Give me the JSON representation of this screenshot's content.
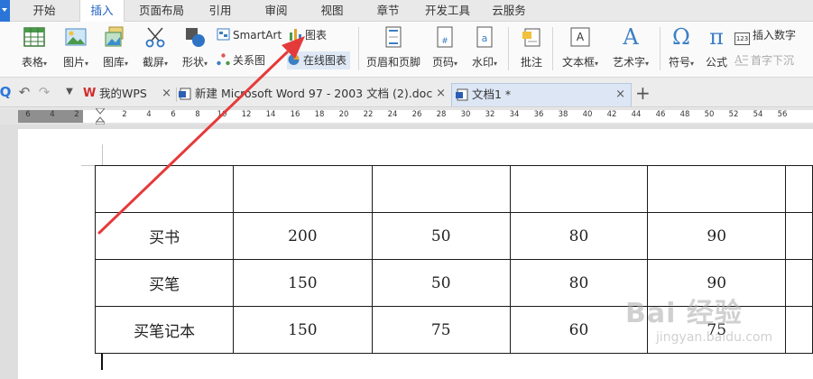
{
  "menu": {
    "items": [
      "开始",
      "插入",
      "页面布局",
      "引用",
      "审阅",
      "视图",
      "章节",
      "开发工具",
      "云服务"
    ],
    "active": "插入"
  },
  "ribbon": {
    "table": "表格",
    "picture": "图片",
    "gallery": "图库",
    "screenshot": "截屏",
    "shape": "形状",
    "smartart": "SmartArt",
    "relation": "关系图",
    "chart": "图表",
    "online_chart": "在线图表",
    "header_footer": "页眉和页脚",
    "page_number": "页码",
    "watermark": "水印",
    "comment": "批注",
    "textbox": "文本框",
    "wordart": "艺术字",
    "symbol": "符号",
    "formula": "公式",
    "insert_number": "插入数字",
    "drop_cap": "首字下沉",
    "dropdown_glyph": "▾",
    "symbol_glyph": "Ω",
    "formula_glyph": "π",
    "wordart_glyph": "A",
    "number_glyph": "123",
    "page_number_glyph": "#",
    "watermark_glyph": "a"
  },
  "tabs": [
    {
      "title": "我的WPS",
      "close": "×"
    },
    {
      "title": "新建 Microsoft Word 97 - 2003 文档 (2).doc",
      "close": "×"
    },
    {
      "title": "文档1 *",
      "close": "×"
    }
  ],
  "tab_icons": {
    "wps": "W"
  },
  "new_tab": "+",
  "quick_access": {
    "undo": "↶",
    "redo": "↷",
    "menu": "▼",
    "magnifier": "Q"
  },
  "ruler": {
    "grey_ticks": [
      "6",
      "4",
      "2"
    ],
    "white_ticks": [
      "2",
      "4",
      "6",
      "8",
      "10",
      "12",
      "14",
      "16",
      "18",
      "20",
      "22",
      "24",
      "26",
      "28",
      "30",
      "32",
      "34",
      "36",
      "38",
      "40",
      "42",
      "44",
      "46",
      "48",
      "50",
      "52",
      "54",
      "56"
    ]
  },
  "table": {
    "rows": [
      [
        "",
        "",
        "",
        "",
        "",
        ""
      ],
      [
        "买书",
        "200",
        "50",
        "80",
        "90",
        ""
      ],
      [
        "买笔",
        "150",
        "50",
        "80",
        "90",
        ""
      ],
      [
        "买笔记本",
        "150",
        "75",
        "60",
        "75",
        ""
      ]
    ]
  },
  "watermark": {
    "main": "Bai 经验",
    "sub": "jingyan.baidu.com"
  },
  "colors": {
    "accent": "#1f5fc4",
    "arrow": "#e53a3a",
    "wps_red": "#d22b2b"
  }
}
